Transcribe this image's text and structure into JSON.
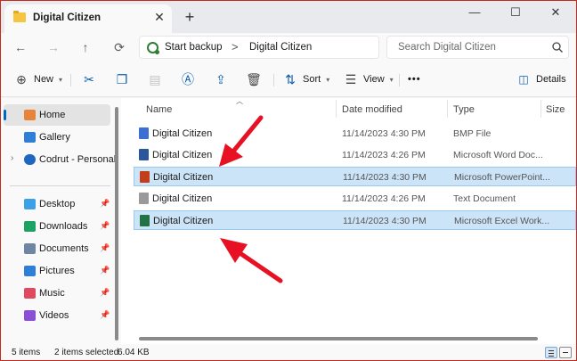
{
  "window": {
    "tab_title": "Digital Citizen",
    "close_tab": "✕",
    "new_tab": "+",
    "minimize": "—",
    "maximize": "☐",
    "close": "✕"
  },
  "nav": {
    "back": "←",
    "forward": "→",
    "up": "↑",
    "refresh": "⟳",
    "breadcrumb_start": "Start backup",
    "breadcrumb_sep": ">",
    "breadcrumb_current": "Digital Citizen",
    "search_placeholder": "Search Digital Citizen"
  },
  "toolbar": {
    "new_label": "New",
    "sort_label": "Sort",
    "view_label": "View",
    "more_label": "•••",
    "details_label": "Details"
  },
  "sidebar": {
    "items": [
      {
        "label": "Home",
        "icon": "home-icon",
        "color": "#e8833a"
      },
      {
        "label": "Gallery",
        "icon": "gallery-icon",
        "color": "#2f7fd6"
      },
      {
        "label": "Codrut - Personal",
        "icon": "onedrive-icon",
        "color": "#1f66c1"
      },
      {
        "label": "Desktop",
        "icon": "desktop-icon",
        "color": "#3ba0e6"
      },
      {
        "label": "Downloads",
        "icon": "downloads-icon",
        "color": "#1ca364"
      },
      {
        "label": "Documents",
        "icon": "documents-icon",
        "color": "#6f86a3"
      },
      {
        "label": "Pictures",
        "icon": "pictures-icon",
        "color": "#2f7fd6"
      },
      {
        "label": "Music",
        "icon": "music-icon",
        "color": "#e04a5e"
      },
      {
        "label": "Videos",
        "icon": "videos-icon",
        "color": "#8b4fd6"
      }
    ]
  },
  "columns": {
    "name": "Name",
    "date": "Date modified",
    "type": "Type",
    "size": "Size"
  },
  "files": [
    {
      "name": "Digital Citizen",
      "date": "11/14/2023 4:30 PM",
      "type": "BMP File",
      "icon": "bmp-file-icon",
      "color": "#3b6fd4",
      "selected": false
    },
    {
      "name": "Digital Citizen",
      "date": "11/14/2023 4:26 PM",
      "type": "Microsoft Word Doc...",
      "icon": "word-file-icon",
      "color": "#2b579a",
      "selected": false
    },
    {
      "name": "Digital Citizen",
      "date": "11/14/2023 4:30 PM",
      "type": "Microsoft PowerPoint...",
      "icon": "powerpoint-file-icon",
      "color": "#c43e1c",
      "selected": true
    },
    {
      "name": "Digital Citizen",
      "date": "11/14/2023 4:26 PM",
      "type": "Text Document",
      "icon": "text-file-icon",
      "color": "#9a9a9a",
      "selected": false
    },
    {
      "name": "Digital Citizen",
      "date": "11/14/2023 4:30 PM",
      "type": "Microsoft Excel Work...",
      "icon": "excel-file-icon",
      "color": "#217346",
      "selected": true
    }
  ],
  "status": {
    "items_count": "5 items",
    "selected": "2 items selected",
    "size": "6.04 KB"
  },
  "colors": {
    "accent": "#0067c0",
    "selection": "#cce4f7",
    "annotation_arrow": "#e81123"
  }
}
